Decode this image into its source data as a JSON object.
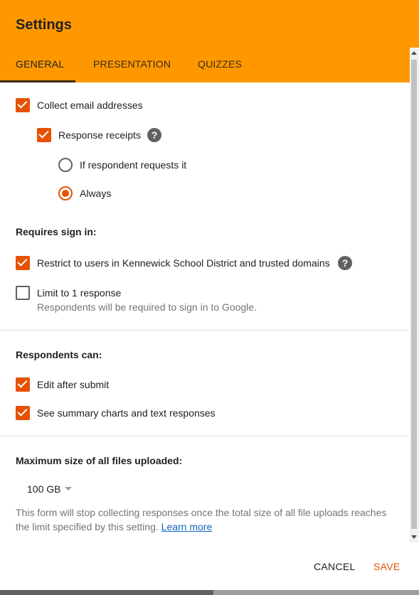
{
  "header": {
    "title": "Settings",
    "accent_color": "#ff9800",
    "tabs": [
      {
        "label": "GENERAL",
        "active": true
      },
      {
        "label": "PRESENTATION",
        "active": false
      },
      {
        "label": "QUIZZES",
        "active": false
      }
    ]
  },
  "general": {
    "collect_email": {
      "label": "Collect email addresses",
      "checked": true
    },
    "response_receipts": {
      "label": "Response receipts",
      "checked": true,
      "help_icon": "help-icon"
    },
    "receipt_options": [
      {
        "label": "If respondent requests it",
        "selected": false
      },
      {
        "label": "Always",
        "selected": true
      }
    ]
  },
  "sign_in": {
    "title": "Requires sign in:",
    "restrict": {
      "label": "Restrict to users in Kennewick School District and trusted domains",
      "checked": true,
      "help_icon": "help-icon"
    },
    "limit": {
      "label": "Limit to 1 response",
      "checked": false,
      "note": "Respondents will be required to sign in to Google."
    }
  },
  "respondents": {
    "title": "Respondents can:",
    "edit_after_submit": {
      "label": "Edit after submit",
      "checked": true
    },
    "see_summary": {
      "label": "See summary charts and text responses",
      "checked": true
    }
  },
  "uploads": {
    "title": "Maximum size of all files uploaded:",
    "selected_value": "100 GB",
    "note": "This form will stop collecting responses once the total size of all file uploads reaches the limit specified by this setting.",
    "learn_more": "Learn more"
  },
  "footer": {
    "cancel_label": "CANCEL",
    "save_label": "SAVE",
    "save_color": "#e65100"
  }
}
